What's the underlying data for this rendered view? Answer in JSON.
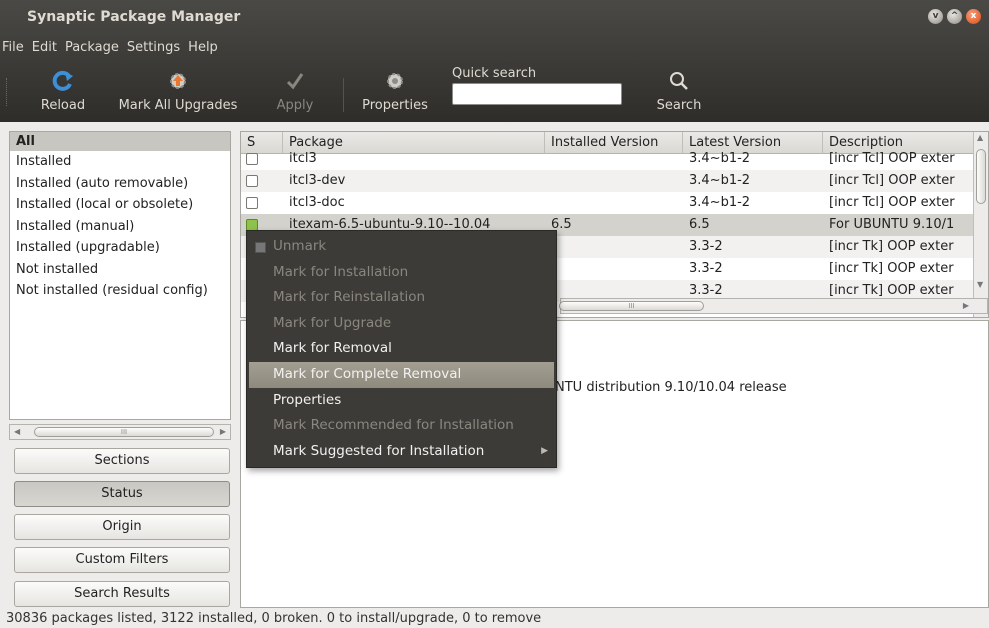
{
  "window": {
    "title": "Synaptic Package Manager",
    "buttons": [
      "v",
      "^",
      "x"
    ]
  },
  "menubar": [
    "File",
    "Edit",
    "Package",
    "Settings",
    "Help"
  ],
  "toolbar": {
    "reload": "Reload",
    "mark_all_upgrades": "Mark All Upgrades",
    "apply": "Apply",
    "properties": "Properties",
    "quick_search_label": "Quick search",
    "quick_search_value": "",
    "search": "Search"
  },
  "filters": {
    "header": "All",
    "items": [
      "Installed",
      "Installed (auto removable)",
      "Installed (local or obsolete)",
      "Installed (manual)",
      "Installed (upgradable)",
      "Not installed",
      "Not installed (residual config)"
    ]
  },
  "nav_buttons": [
    "Sections",
    "Status",
    "Origin",
    "Custom Filters",
    "Search Results"
  ],
  "table": {
    "columns": [
      "S",
      "Package",
      "Installed Version",
      "Latest Version",
      "Description"
    ],
    "rows": [
      {
        "package": "itcl3",
        "installed": "",
        "latest": "3.4~b1-2",
        "desc": "[incr Tcl] OOP exter"
      },
      {
        "package": "itcl3-dev",
        "installed": "",
        "latest": "3.4~b1-2",
        "desc": "[incr Tcl] OOP exter"
      },
      {
        "package": "itcl3-doc",
        "installed": "",
        "latest": "3.4~b1-2",
        "desc": "[incr Tcl] OOP exter"
      },
      {
        "package": "itexam-6.5-ubuntu-9.10--10.04",
        "installed": "6.5",
        "latest": "6.5",
        "desc": "For UBUNTU 9.10/1"
      },
      {
        "package": "",
        "installed": "",
        "latest": "3.3-2",
        "desc": "[incr Tk] OOP exter"
      },
      {
        "package": "",
        "installed": "",
        "latest": "3.3-2",
        "desc": "[incr Tk] OOP exter"
      },
      {
        "package": "",
        "installed": "",
        "latest": "3.3-2",
        "desc": "[incr Tk] OOP exter"
      }
    ]
  },
  "description_text": "NTU distribution 9.10/10.04  release",
  "context_menu": [
    {
      "label": "Unmark",
      "enabled": false
    },
    {
      "label": "Mark for Installation",
      "enabled": false
    },
    {
      "label": "Mark for Reinstallation",
      "enabled": false
    },
    {
      "label": "Mark for Upgrade",
      "enabled": false
    },
    {
      "label": "Mark for Removal",
      "enabled": true
    },
    {
      "label": "Mark for Complete Removal",
      "enabled": true,
      "highlighted": true
    },
    {
      "label": "Properties",
      "enabled": true
    },
    {
      "label": "Mark Recommended for Installation",
      "enabled": false
    },
    {
      "label": "Mark Suggested for Installation",
      "enabled": true,
      "submenu": true
    }
  ],
  "status": "30836 packages listed, 3122 installed, 0 broken. 0 to install/upgrade, 0 to remove",
  "scroll_thumb_mark": "III"
}
